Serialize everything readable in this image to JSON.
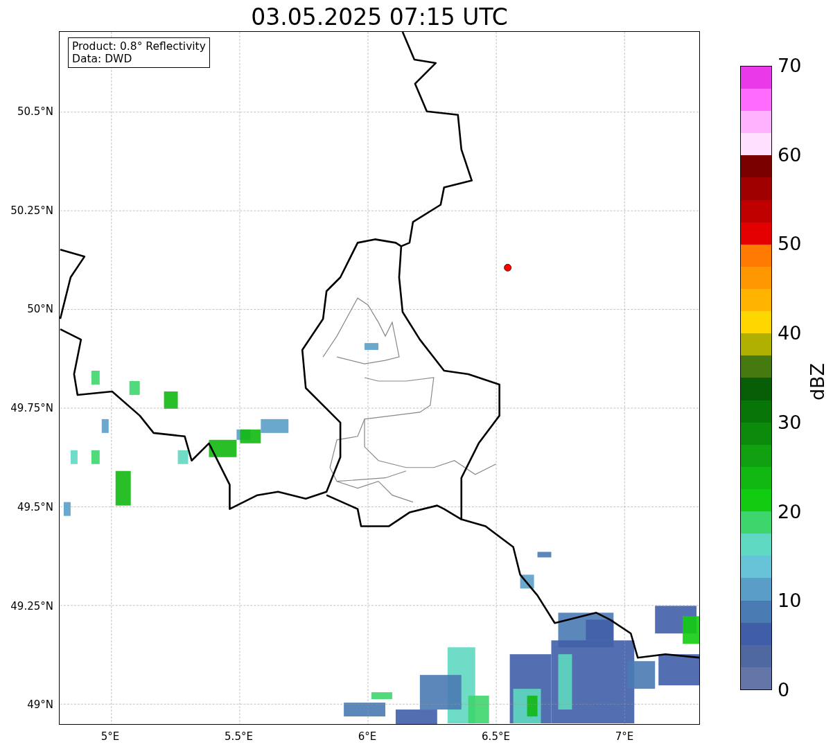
{
  "title": "03.05.2025 07:15 UTC",
  "info_box": {
    "lines": [
      "Product: 0.8° Reflectivity",
      "Data: DWD"
    ]
  },
  "lat_ticks": [
    "50.5°N",
    "50.25°N",
    "50°N",
    "49.75°N",
    "49.5°N",
    "49.25°N",
    "49°N"
  ],
  "lon_ticks": [
    "5°E",
    "5.5°E",
    "6°E",
    "6.5°E",
    "7°E"
  ],
  "colorbar": {
    "label": "dBZ",
    "ticks": [
      "70",
      "60",
      "50",
      "40",
      "30",
      "20",
      "10",
      "0"
    ],
    "bands": [
      {
        "color": "#6475a8"
      },
      {
        "color": "#5068a0"
      },
      {
        "color": "#405ea8"
      },
      {
        "color": "#4a7ab2"
      },
      {
        "color": "#5a9ec8"
      },
      {
        "color": "#66c3d8"
      },
      {
        "color": "#5ed8c0"
      },
      {
        "color": "#3dd66d"
      },
      {
        "color": "#12cc12"
      },
      {
        "color": "#12b812"
      },
      {
        "color": "#10a010"
      },
      {
        "color": "#0b8a0b"
      },
      {
        "color": "#077507"
      },
      {
        "color": "#075e07"
      },
      {
        "color": "#457a10"
      },
      {
        "color": "#b0b000"
      },
      {
        "color": "#ffd700"
      },
      {
        "color": "#ffb400"
      },
      {
        "color": "#ff9800"
      },
      {
        "color": "#ff7a00"
      },
      {
        "color": "#e40000"
      },
      {
        "color": "#c00000"
      },
      {
        "color": "#a00000"
      },
      {
        "color": "#7a0000"
      },
      {
        "color": "#ffe0ff"
      },
      {
        "color": "#ffb3ff"
      },
      {
        "color": "#ff6aff"
      },
      {
        "color": "#ea3ae8"
      }
    ]
  }
}
